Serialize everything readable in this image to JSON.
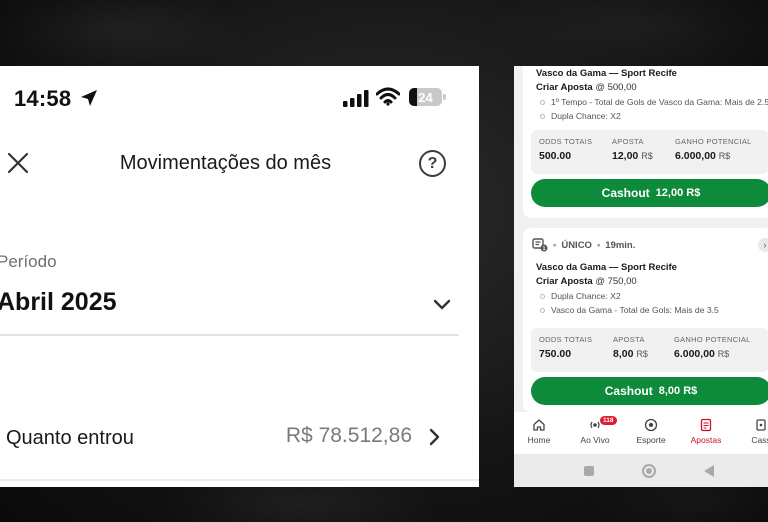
{
  "left": {
    "status": {
      "time": "14:58",
      "battery": "24",
      "battery_level": 0.24
    },
    "title": "Movimentações do mês",
    "period_label": "Período",
    "period_value": "Abril 2025",
    "income_label": "Quanto entrou",
    "income_value": "R$ 78.512,86"
  },
  "right": {
    "bets": [
      {
        "match": "Vasco da Gama — Sport Recife",
        "create_label": "Criar Aposta",
        "create_odds": "@ 500,00",
        "selections": [
          "1º Tempo - Total de Gols de Vasco da Gama: Mais de 2.5",
          "Dupla Chance: X2"
        ],
        "odds_label": "ODDS TOTAIS",
        "odds_value": "500.00",
        "stake_label": "APOSTA",
        "stake_value": "12,00",
        "gain_label": "GANHO POTENCIAL",
        "gain_value": "6.000,00",
        "currency": "R$",
        "cashout_label": "Cashout",
        "cashout_value": "12,00 R$"
      },
      {
        "type": "ÚNICO",
        "time": "19min.",
        "match": "Vasco da Gama — Sport Recife",
        "create_label": "Criar Aposta",
        "create_odds": "@ 750,00",
        "selections": [
          "Dupla Chance: X2",
          "Vasco da Gama - Total de Gols: Mais de 3.5"
        ],
        "odds_label": "ODDS TOTAIS",
        "odds_value": "750.00",
        "stake_label": "APOSTA",
        "stake_value": "8,00",
        "gain_label": "GANHO POTENCIAL",
        "gain_value": "6.000,00",
        "currency": "R$",
        "cashout_label": "Cashout",
        "cashout_value": "8,00 R$"
      }
    ],
    "nav": [
      {
        "label": "Home",
        "icon": "home-icon"
      },
      {
        "label": "Ao Vivo",
        "icon": "live-icon",
        "badge": "118"
      },
      {
        "label": "Esporte",
        "icon": "soccer-ball-icon"
      },
      {
        "label": "Apostas",
        "icon": "bets-icon"
      },
      {
        "label": "Cass",
        "icon": "casino-icon"
      }
    ],
    "colors": {
      "cashout": "#0e8a3b",
      "active_nav": "#d0102a",
      "badge": "#e01b2f"
    }
  }
}
